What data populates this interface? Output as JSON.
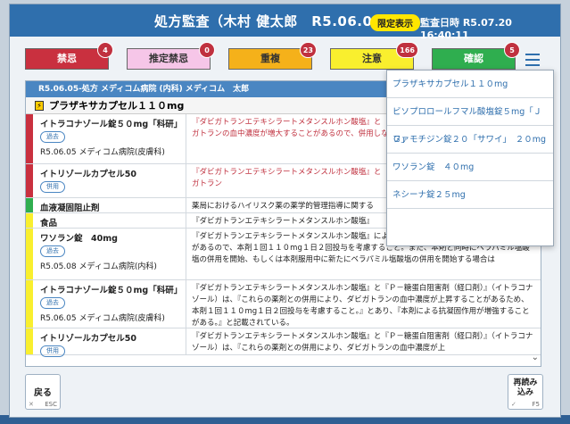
{
  "dialog": {
    "title": "処方監査（木村 健太郎　R5.06.05）",
    "limited_badge": "限定表示",
    "audit_time": "監査日時 R5.07.20 16:40:11"
  },
  "categories": [
    {
      "label": "禁忌",
      "count": "4",
      "color": "#c9303f",
      "text_color": "#ffffff"
    },
    {
      "label": "推定禁忌",
      "count": "0",
      "color": "#f6c6e8",
      "text_color": "#333333"
    },
    {
      "label": "重複",
      "count": "23",
      "color": "#f5b11a",
      "text_color": "#333333"
    },
    {
      "label": "注意",
      "count": "166",
      "color": "#f9ef2e",
      "text_color": "#333333"
    },
    {
      "label": "確認",
      "count": "5",
      "color": "#2fae4f",
      "text_color": "#ffffff"
    }
  ],
  "menu_icon": "hamburger-icon",
  "panel": {
    "header": "R5.06.05-処方 メディコム病院 (内科) メディコム　太郎",
    "drug_head": "プラザキサカプセル１１０mg",
    "rows": [
      {
        "bar": "#c9303f",
        "name": "イトラコナゾール錠５０mg「科研」",
        "tag": "過去",
        "meta": "R5.06.05 メディコム病院(皮膚科)",
        "text": "『ダビガトランエテキシラートメタンスルホン酸塩』と（イトラコナゾール）は、『併用によりダビガトランの血中濃度が増大することがあるので、併用しないこと。』と記載されている。【併用禁忌】",
        "red": true
      },
      {
        "bar": "#c9303f",
        "name": "イトリゾールカプセル50",
        "tag": "併用",
        "meta": "",
        "text": "『ダビガトランエテキシラートメタンスルホン酸塩』と（イトラコナゾール）は、『併用によりダビガトラン",
        "red": true
      },
      {
        "bar": "#2fae4f",
        "name": "血液凝固阻止剤",
        "tag": "",
        "meta": "",
        "text": "薬局におけるハイリスク薬の薬学的管理指導に関する",
        "red": false
      },
      {
        "bar": "#f9ef2e",
        "name": "食品",
        "tag": "",
        "meta": "",
        "text": "『ダビガトランエテキシラートメタンスルホン酸塩』",
        "red": false
      },
      {
        "bar": "#f9ef2e",
        "name": "ワソラン錠　40mg",
        "tag": "過去",
        "meta": "R5.05.08 メディコム病院(内科)",
        "text": "『ダビガトランエテキシラートメタンスルホン酸塩』によりダビガトランの血中濃度が上昇することがあるので、本剤１回１１０mg１日２回投与を考慮すること。また、本剤と同時にベラパミル塩酸塩の併用を開始、もしくは本剤服用中に新たにベラパミル塩酸塩の併用を開始する場合は",
        "red": false
      },
      {
        "bar": "#f9ef2e",
        "name": "イトラコナゾール錠５０mg「科研」",
        "tag": "過去",
        "meta": "R5.06.05 メディコム病院(皮膚科)",
        "text": "『ダビガトランエテキシラートメタンスルホン酸塩』と『Ｐ－糖蛋白阻害剤（経口剤）』（イトラコナゾール）は、『これらの薬剤との併用により、ダビガトランの血中濃度が上昇することがあるため、本剤１回１１０mg１日２回投与を考慮すること。』とあり、『本剤による抗凝固作用が増強することがある。』と記載されている。",
        "red": false
      },
      {
        "bar": "#f9ef2e",
        "name": "イトリゾールカプセル50",
        "tag": "併用",
        "meta": "",
        "text": "『ダビガトランエテキシラートメタンスルホン酸塩』と『Ｐ－糖蛋白阻害剤（経口剤）』（イトラコナゾール）は、『これらの薬剤との併用により、ダビガトランの血中濃度が上",
        "red": false
      }
    ]
  },
  "dropdown": {
    "items": [
      "プラザキサカプセル１１０mg",
      "ビソプロロールフマル酸塩錠５mg「ＪＧ」",
      "ファモチジン錠２０「サワイ」　２０mg",
      "ワソラン錠　４０mg",
      "ネシーナ錠２５mg"
    ]
  },
  "footer": {
    "back_label": "戻る",
    "back_key": "ESC",
    "reload_label": "再読み込み",
    "reload_key": "F5"
  }
}
